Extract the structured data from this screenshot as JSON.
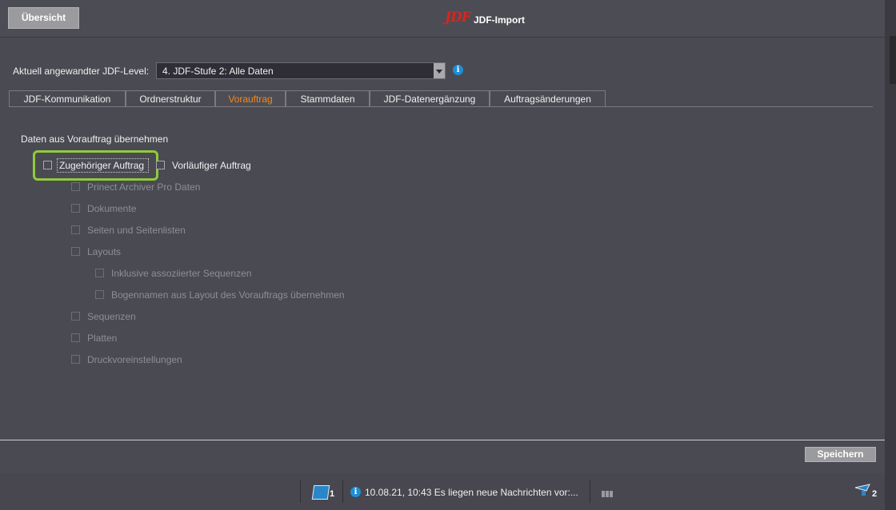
{
  "header": {
    "overview_label": "Übersicht",
    "logo_text": "JDF",
    "title": "JDF-Import"
  },
  "level": {
    "label": "Aktuell angewandter JDF-Level:",
    "selected": "4. JDF-Stufe 2: Alle Daten",
    "info_icon": "info-icon"
  },
  "tabs": [
    {
      "label": "JDF-Kommunikation",
      "active": false
    },
    {
      "label": "Ordnerstruktur",
      "active": false
    },
    {
      "label": "Vorauftrag",
      "active": true
    },
    {
      "label": "Stammdaten",
      "active": false
    },
    {
      "label": "JDF-Datenergänzung",
      "active": false
    },
    {
      "label": "Auftragsänderungen",
      "active": false
    }
  ],
  "section": {
    "title": "Daten aus Vorauftrag übernehmen",
    "options": [
      {
        "label": "Zugehöriger Auftrag",
        "checked": false,
        "enabled": true
      },
      {
        "label": "Vorläufiger Auftrag",
        "checked": false,
        "enabled": true
      },
      {
        "label": "Prinect Archiver Pro Daten",
        "checked": false,
        "enabled": false
      },
      {
        "label": "Dokumente",
        "checked": false,
        "enabled": false
      },
      {
        "label": "Seiten und Seitenlisten",
        "checked": false,
        "enabled": false
      },
      {
        "label": "Layouts",
        "checked": false,
        "enabled": false
      },
      {
        "label": "Inklusive assoziierter Sequenzen",
        "checked": false,
        "enabled": false
      },
      {
        "label": "Bogennamen aus Layout des Vorauftrags übernehmen",
        "checked": false,
        "enabled": false
      },
      {
        "label": "Sequenzen",
        "checked": false,
        "enabled": false
      },
      {
        "label": "Platten",
        "checked": false,
        "enabled": false
      },
      {
        "label": "Druckvoreinstellungen",
        "checked": false,
        "enabled": false
      }
    ]
  },
  "footer": {
    "save_label": "Speichern"
  },
  "statusbar": {
    "network_count": "1",
    "message": "10.08.21, 10:43  Es liegen neue Nachrichten vor:...",
    "users_count": "2"
  },
  "colors": {
    "active_tab": "#f08a1a",
    "highlight": "#8fcb3a",
    "info": "#1e8ed6",
    "logo": "#d6261f"
  }
}
